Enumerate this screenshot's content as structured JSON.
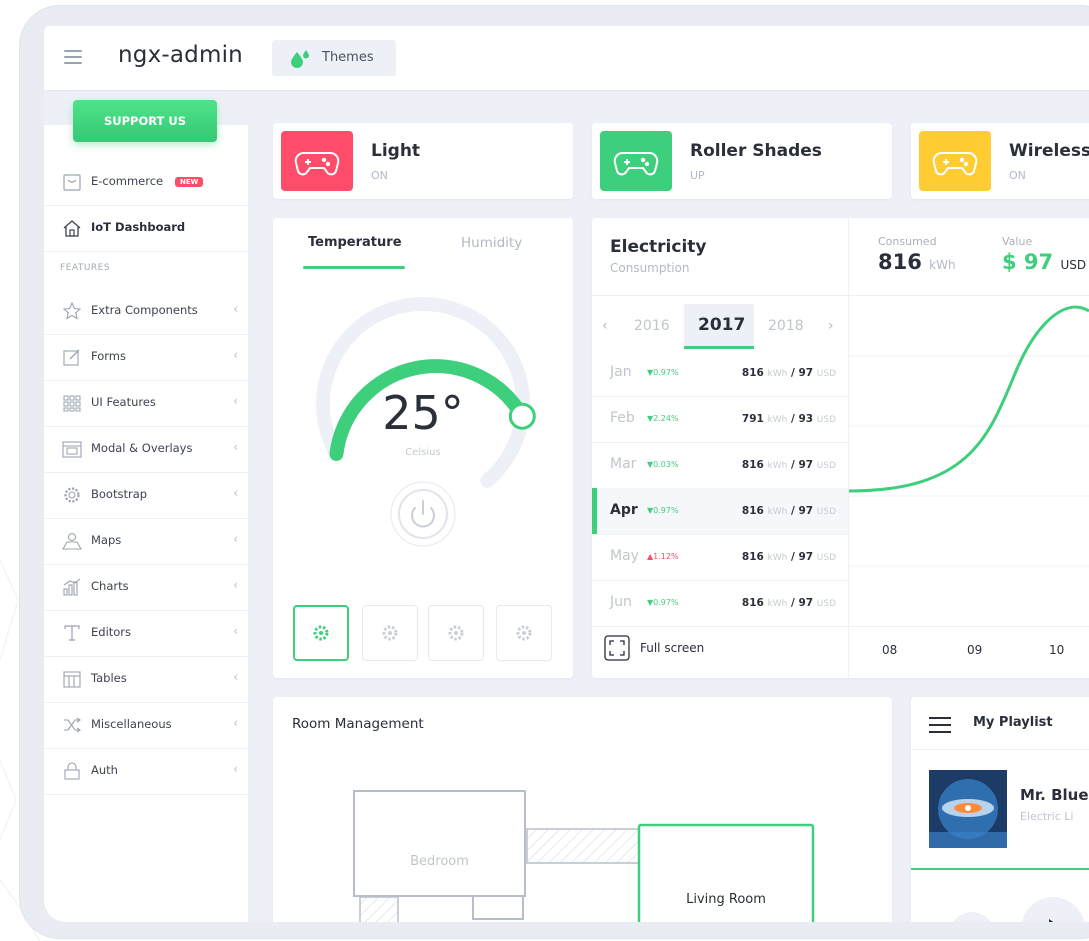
{
  "app": {
    "title": "ngx-admin",
    "themes_label": "Themes"
  },
  "sidebar": {
    "support_label": "SUPPORT US",
    "badge_new": "NEW",
    "section_features": "FEATURES",
    "items": [
      {
        "label": "E-commerce",
        "icon": "ecommerce-icon"
      },
      {
        "label": "IoT Dashboard",
        "icon": "home-icon"
      },
      {
        "label": "Extra Components",
        "icon": "star-icon"
      },
      {
        "label": "Forms",
        "icon": "edit-icon"
      },
      {
        "label": "UI Features",
        "icon": "keypad-icon"
      },
      {
        "label": "Modal & Overlays",
        "icon": "browser-icon"
      },
      {
        "label": "Bootstrap",
        "icon": "gear-icon"
      },
      {
        "label": "Maps",
        "icon": "map-icon"
      },
      {
        "label": "Charts",
        "icon": "chart-icon"
      },
      {
        "label": "Editors",
        "icon": "text-icon"
      },
      {
        "label": "Tables",
        "icon": "grid-icon"
      },
      {
        "label": "Miscellaneous",
        "icon": "shuffle-icon"
      },
      {
        "label": "Auth",
        "icon": "lock-icon"
      }
    ]
  },
  "status_cards": [
    {
      "title": "Light",
      "status": "ON",
      "color": "#ff4c6a"
    },
    {
      "title": "Roller Shades",
      "status": "UP",
      "color": "#3ecf7d"
    },
    {
      "title": "Wireless",
      "status": "ON",
      "color": "#ffcc33"
    }
  ],
  "temperature": {
    "tab_temperature": "Temperature",
    "tab_humidity": "Humidity",
    "value": "25°",
    "unit": "Celsius",
    "level": 0.55
  },
  "electricity": {
    "title": "Electricity",
    "subtitle": "Consumption",
    "years": [
      "2016",
      "2017",
      "2018"
    ],
    "selected_year": "2017",
    "months": [
      {
        "m": "Jan",
        "delta": "▼0.97%",
        "kwh": "816",
        "usd": "97",
        "up": false
      },
      {
        "m": "Feb",
        "delta": "▼2.24%",
        "kwh": "791",
        "usd": "93",
        "up": false
      },
      {
        "m": "Mar",
        "delta": "▼0.03%",
        "kwh": "816",
        "usd": "97",
        "up": false
      },
      {
        "m": "Apr",
        "delta": "▼0.97%",
        "kwh": "816",
        "usd": "97",
        "up": false
      },
      {
        "m": "May",
        "delta": "▲1.12%",
        "kwh": "816",
        "usd": "97",
        "up": true
      },
      {
        "m": "Jun",
        "delta": "▼0.97%",
        "kwh": "816",
        "usd": "97",
        "up": false
      }
    ],
    "unit_kwh": "kWh",
    "unit_usd": "USD",
    "fullscreen_label": "Full screen",
    "consumed_label": "Consumed",
    "consumed_value": "816",
    "value_label": "Value",
    "value_value": "$ 97",
    "x_ticks": [
      "08",
      "09",
      "10"
    ]
  },
  "room": {
    "title": "Room Management",
    "bedroom": "Bedroom",
    "living_room": "Living Room"
  },
  "playlist": {
    "title": "My Playlist",
    "track": "Mr. Blue",
    "artist": "Electric Li"
  },
  "colors": {
    "accent": "#3ecf7d",
    "danger": "#ff4c6a",
    "warning": "#ffcc33"
  }
}
